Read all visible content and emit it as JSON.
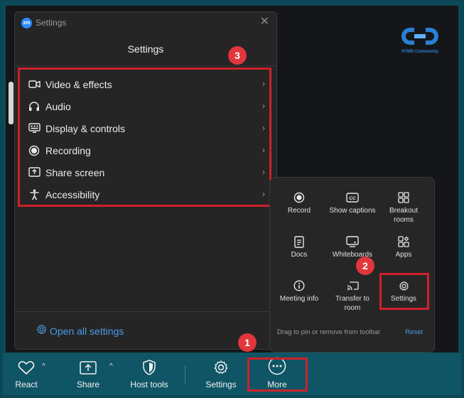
{
  "logo": {
    "text": "HTMD Community"
  },
  "settings_window": {
    "badge_text": "zm",
    "title": "Settings",
    "close_icon": "close-icon",
    "header": "Settings",
    "items": [
      {
        "label": "Video & effects",
        "icon": "video-camera-icon"
      },
      {
        "label": "Audio",
        "icon": "headphones-icon"
      },
      {
        "label": "Display & controls",
        "icon": "display-icon"
      },
      {
        "label": "Recording",
        "icon": "record-icon"
      },
      {
        "label": "Share screen",
        "icon": "share-screen-icon"
      },
      {
        "label": "Accessibility",
        "icon": "accessibility-icon"
      }
    ],
    "footer_link": "Open all settings"
  },
  "more_panel": {
    "tiles": [
      {
        "label": "Record",
        "icon": "record-icon"
      },
      {
        "label": "Show captions",
        "icon": "closed-captions-icon"
      },
      {
        "label": "Breakout rooms",
        "icon": "breakout-rooms-icon"
      },
      {
        "label": "Docs",
        "icon": "docs-icon"
      },
      {
        "label": "Whiteboards",
        "icon": "whiteboard-icon"
      },
      {
        "label": "Apps",
        "icon": "apps-icon"
      },
      {
        "label": "Meeting info",
        "icon": "info-icon"
      },
      {
        "label": "Transfer to room",
        "icon": "cast-icon"
      },
      {
        "label": "Settings",
        "icon": "gear-icon"
      }
    ],
    "footer_text": "Drag to pin or remove from toolbar",
    "reset_label": "Reset"
  },
  "toolbar": {
    "items": [
      {
        "label": "React",
        "icon": "heart-icon"
      },
      {
        "label": "Share",
        "icon": "share-icon"
      },
      {
        "label": "Host tools",
        "icon": "shield-icon"
      },
      {
        "label": "Settings",
        "icon": "gear-icon"
      },
      {
        "label": "More",
        "icon": "more-icon"
      }
    ],
    "caret": "^"
  },
  "annotations": {
    "step1": "1",
    "step2": "2",
    "step3": "3"
  },
  "colors": {
    "highlight": "#d0202a",
    "badge": "#e0363c",
    "link": "#4a9be8",
    "toolbar_bg": "#0f5565"
  }
}
